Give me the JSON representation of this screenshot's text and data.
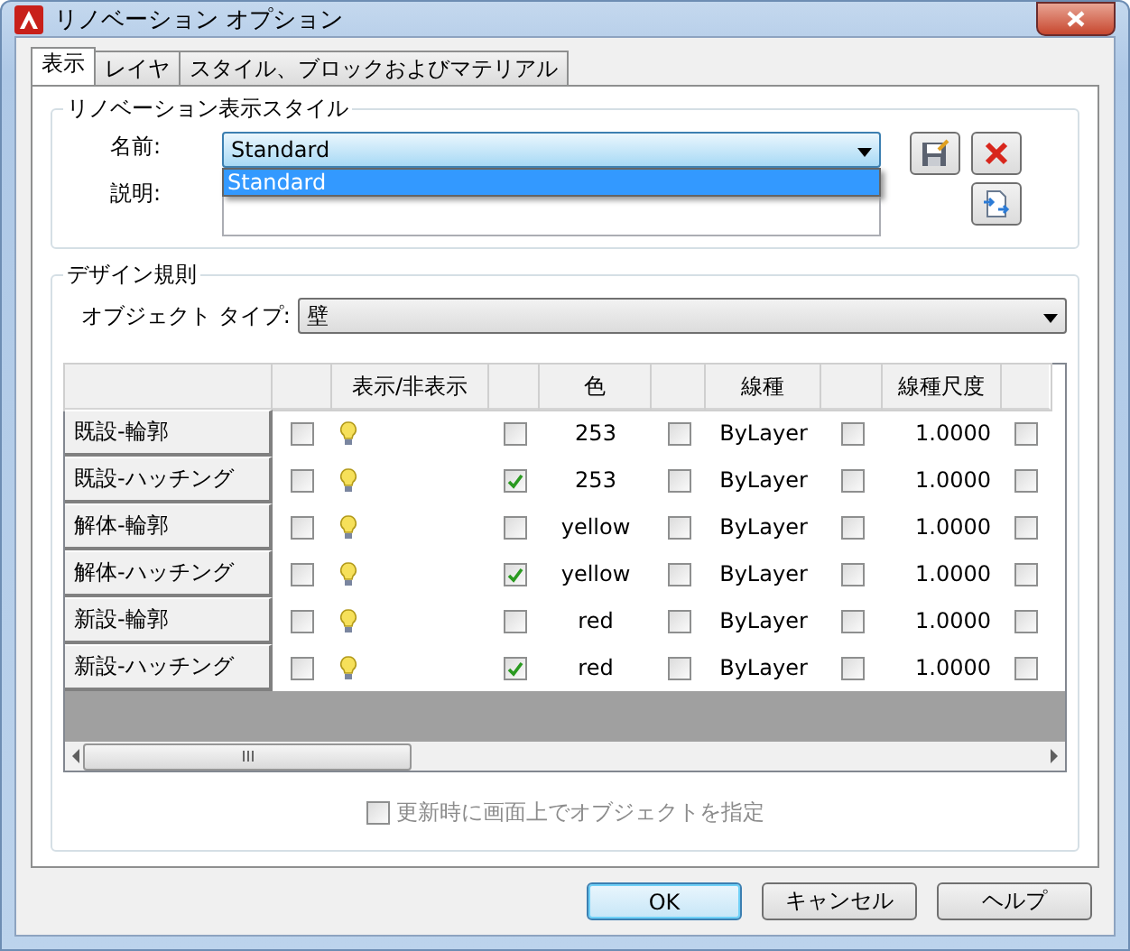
{
  "window": {
    "title": "リノベーション オプション"
  },
  "tabs": [
    {
      "label": "表示",
      "selected": true
    },
    {
      "label": "レイヤ",
      "selected": false
    },
    {
      "label": "スタイル、ブロックおよびマテリアル",
      "selected": false
    }
  ],
  "style_group": {
    "title": "リノベーション表示スタイル",
    "name_label": "名前:",
    "name_value": "Standard",
    "dropdown_options": [
      {
        "label": "Standard",
        "selected": true
      }
    ],
    "description_label": "説明:"
  },
  "design_group": {
    "title": "デザイン規則",
    "object_type_label": "オブジェクト タイプ:",
    "object_type_value": "壁"
  },
  "table": {
    "columns": [
      {
        "label": "表示/非表示"
      },
      {
        "label": "色"
      },
      {
        "label": "線種"
      },
      {
        "label": "線種尺度"
      }
    ],
    "rows": [
      {
        "name": "既設-輪郭",
        "flags": [
          false,
          false,
          false,
          false,
          false
        ],
        "visible": true,
        "color_name": "253",
        "linetype": "ByLayer",
        "scale": "1.0000"
      },
      {
        "name": "既設-ハッチング",
        "flags": [
          false,
          true,
          false,
          false,
          false
        ],
        "visible": true,
        "color_name": "253",
        "linetype": "ByLayer",
        "scale": "1.0000"
      },
      {
        "name": "解体-輪郭",
        "flags": [
          false,
          false,
          false,
          false,
          false
        ],
        "visible": true,
        "color_name": "yellow",
        "linetype": "ByLayer",
        "scale": "1.0000"
      },
      {
        "name": "解体-ハッチング",
        "flags": [
          false,
          true,
          false,
          false,
          false
        ],
        "visible": true,
        "color_name": "yellow",
        "linetype": "ByLayer",
        "scale": "1.0000"
      },
      {
        "name": "新設-輪郭",
        "flags": [
          false,
          false,
          false,
          false,
          false
        ],
        "visible": true,
        "color_name": "red",
        "linetype": "ByLayer",
        "scale": "1.0000"
      },
      {
        "name": "新設-ハッチング",
        "flags": [
          false,
          true,
          false,
          false,
          false
        ],
        "visible": true,
        "color_name": "red",
        "linetype": "ByLayer",
        "scale": "1.0000"
      }
    ]
  },
  "pick_on_update": {
    "label": "更新時に画面上でオブジェクトを指定",
    "checked": false,
    "disabled": true
  },
  "buttons": [
    {
      "label": "OK",
      "kind": "default"
    },
    {
      "label": "キャンセル",
      "kind": "normal"
    },
    {
      "label": "ヘルプ",
      "kind": "normal"
    }
  ]
}
